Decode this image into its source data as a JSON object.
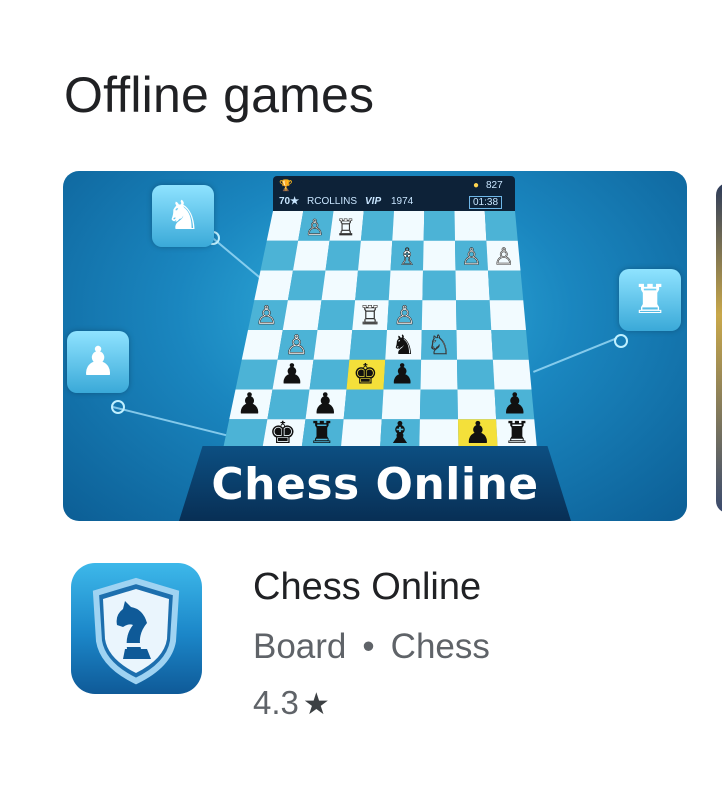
{
  "section": {
    "title": "Offline games"
  },
  "banner": {
    "title": "Chess Online",
    "topbar": {
      "player_rating": "70★",
      "player_name": "RCOLLINS",
      "player_badge": "VIP",
      "player_score": "1974",
      "coins": "827",
      "timer": "01:38"
    }
  },
  "app": {
    "name": "Chess Online",
    "category": "Board",
    "subcategory": "Chess",
    "separator": "•",
    "rating": "4.3",
    "rating_icon": "star-icon"
  },
  "colors": {
    "accent": "#1a86bf",
    "text_primary": "#202124",
    "text_secondary": "#5f6368"
  }
}
